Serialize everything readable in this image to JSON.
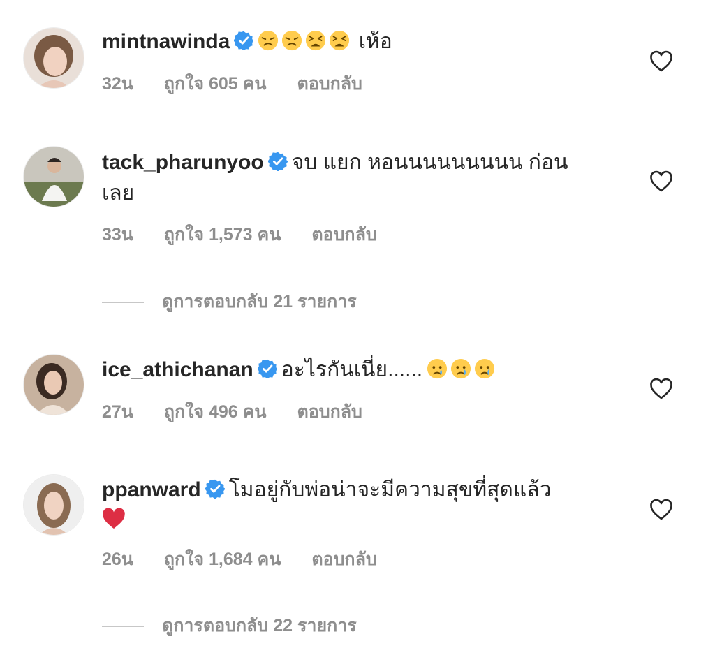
{
  "colors": {
    "text": "#262626",
    "muted": "#8e8e8e",
    "verified": "#3897f0",
    "heart_red": "#ed4956"
  },
  "comments": [
    {
      "username": "mintnawinda",
      "text_after": "เห้อ",
      "emojis": [
        "disappointed-face",
        "disappointed-face",
        "tired-face",
        "tired-face"
      ],
      "time": "32น",
      "likes": "ถูกใจ 605 คน",
      "reply": "ตอบกลับ"
    },
    {
      "username": "tack_pharunyoo",
      "text": "จบ แยก หอนนนนนนนนน ก่อน",
      "text_line2": "เลย",
      "time": "33น",
      "likes": "ถูกใจ 1,573 คน",
      "reply": "ตอบกลับ",
      "view_replies": "ดูการตอบกลับ 21 รายการ"
    },
    {
      "username": "ice_athichanan",
      "text": "อะไรกันเนี่ย......",
      "emojis": [
        "crying-face",
        "crying-face",
        "crying-face"
      ],
      "time": "27น",
      "likes": "ถูกใจ 496 คน",
      "reply": "ตอบกลับ"
    },
    {
      "username": "ppanward",
      "text": "โมอยู่กับพ่อน่าจะมีความสุขที่สุดแล้ว",
      "emojis_line2": [
        "red-heart"
      ],
      "time": "26น",
      "likes": "ถูกใจ 1,684 คน",
      "reply": "ตอบกลับ",
      "view_replies": "ดูการตอบกลับ 22 รายการ"
    }
  ]
}
